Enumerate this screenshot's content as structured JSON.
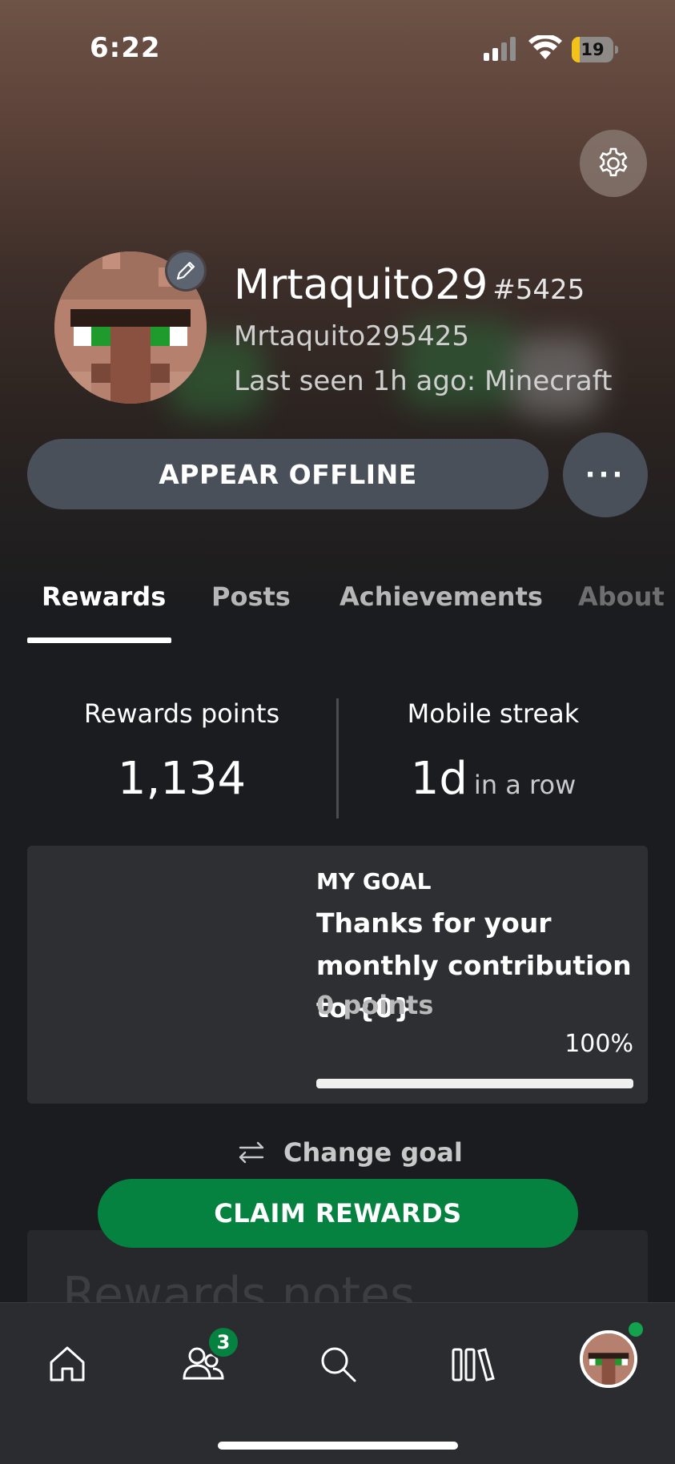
{
  "status_bar": {
    "time": "6:22",
    "battery": "19",
    "battery_color": "#f2c21a"
  },
  "profile": {
    "gamertag": "Mrtaquito29",
    "gamertag_suffix": "#5425",
    "real_name": "Mrtaquito295425",
    "last_seen": "Last seen 1h ago: Minecraft",
    "icons": {
      "settings": "gear-icon",
      "edit": "pencil-icon"
    }
  },
  "actions": {
    "appear_offline": "APPEAR OFFLINE",
    "more": "···"
  },
  "tabs": [
    {
      "label": "Rewards",
      "active": true
    },
    {
      "label": "Posts",
      "active": false
    },
    {
      "label": "Achievements",
      "active": false
    },
    {
      "label": "About",
      "active": false
    }
  ],
  "stats": {
    "rewards_points_label": "Rewards points",
    "rewards_points_value": "1,134",
    "mobile_streak_label": "Mobile streak",
    "mobile_streak_value": "1d",
    "mobile_streak_unit": "in a row"
  },
  "goal": {
    "heading": "MY GOAL",
    "title": "Thanks for your monthly contribution to {0}",
    "points": "0 points",
    "percent_label": "100%",
    "progress": 1.0
  },
  "change_goal": "Change goal",
  "claim_rewards": "CLAIM REWARDS",
  "rewards_notes": "Rewards notes",
  "nav": {
    "friends_badge": "3",
    "items": [
      "home-icon",
      "friends-icon",
      "search-icon",
      "library-icon",
      "profile-avatar"
    ]
  },
  "colors": {
    "accent_green": "#058240",
    "button_gray": "#4a505a",
    "card_bg": "#2d2f33"
  }
}
